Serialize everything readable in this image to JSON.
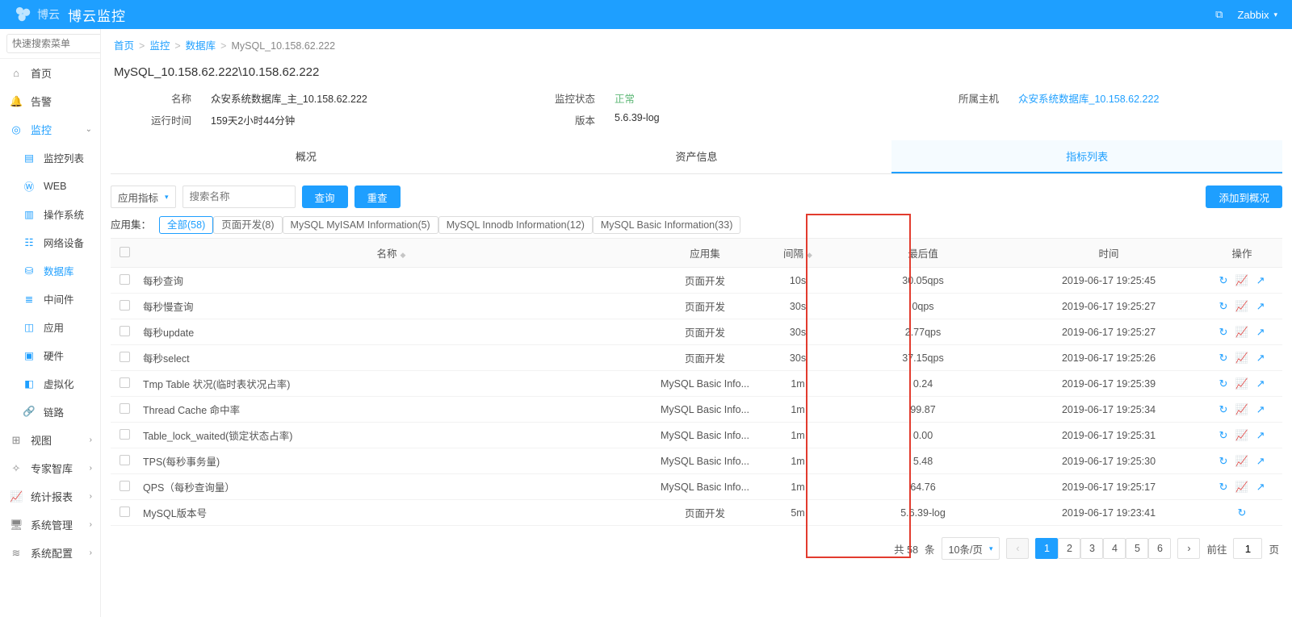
{
  "topbar": {
    "brand": "博云",
    "title": "博云监控",
    "user": "Zabbix"
  },
  "sidebar": {
    "search_placeholder": "快速搜索菜单",
    "items": [
      {
        "icon": "⌂",
        "label": "首页"
      },
      {
        "icon": "🔔",
        "label": "告警"
      },
      {
        "icon": "◎",
        "label": "监控",
        "open": true,
        "children": [
          {
            "icon": "▤",
            "label": "监控列表"
          },
          {
            "icon": "Ⓦ",
            "label": "WEB"
          },
          {
            "icon": "▥",
            "label": "操作系统"
          },
          {
            "icon": "☷",
            "label": "网络设备"
          },
          {
            "icon": "⛁",
            "label": "数据库",
            "active": true
          },
          {
            "icon": "≣",
            "label": "中间件"
          },
          {
            "icon": "◫",
            "label": "应用"
          },
          {
            "icon": "▣",
            "label": "硬件"
          },
          {
            "icon": "◧",
            "label": "虚拟化"
          },
          {
            "icon": "🔗",
            "label": "链路"
          }
        ]
      },
      {
        "icon": "⊞",
        "label": "视图",
        "chev": true
      },
      {
        "icon": "✧",
        "label": "专家智库",
        "chev": true
      },
      {
        "icon": "📈",
        "label": "统计报表",
        "chev": true
      },
      {
        "icon": "🖥",
        "label": "系统管理",
        "chev": true
      },
      {
        "icon": "≋",
        "label": "系统配置",
        "chev": true
      }
    ]
  },
  "breadcrumb": [
    "首页",
    "监控",
    "数据库",
    "MySQL_10.158.62.222"
  ],
  "page_title": "MySQL_10.158.62.222\\10.158.62.222",
  "info": {
    "r1": {
      "name_lab": "名称",
      "name_val": "众安系统数据库_主_10.158.62.222",
      "status_lab": "监控状态",
      "status_val": "正常",
      "host_lab": "所属主机",
      "host_val": "众安系统数据库_10.158.62.222"
    },
    "r2": {
      "uptime_lab": "运行时间",
      "uptime_val": "159天2小时44分钟",
      "ver_lab": "版本",
      "ver_val": "5.6.39-log"
    }
  },
  "tabs": [
    "概况",
    "资产信息",
    "指标列表"
  ],
  "toolbar": {
    "select_label": "应用指标",
    "search_placeholder": "搜索名称",
    "query": "查询",
    "reset": "重查",
    "add_overview": "添加到概况"
  },
  "filters": {
    "label": "应用集：",
    "items": [
      {
        "label": "全部(58)",
        "active": true
      },
      {
        "label": "页面开发(8)"
      },
      {
        "label": "MySQL MyISAM Information(5)"
      },
      {
        "label": "MySQL Innodb Information(12)"
      },
      {
        "label": "MySQL Basic Information(33)"
      }
    ]
  },
  "columns": [
    "",
    "名称",
    "应用集",
    "间隔",
    "最后值",
    "时间",
    "操作"
  ],
  "rows": [
    {
      "name": "每秒查询",
      "set": "页面开发",
      "intv": "10s",
      "last": "30.05qps",
      "time": "2019-06-17 19:25:45",
      "ops": 3
    },
    {
      "name": "每秒慢查询",
      "set": "页面开发",
      "intv": "30s",
      "last": "0qps",
      "time": "2019-06-17 19:25:27",
      "ops": 3
    },
    {
      "name": "每秒update",
      "set": "页面开发",
      "intv": "30s",
      "last": "2.77qps",
      "time": "2019-06-17 19:25:27",
      "ops": 3
    },
    {
      "name": "每秒select",
      "set": "页面开发",
      "intv": "30s",
      "last": "37.15qps",
      "time": "2019-06-17 19:25:26",
      "ops": 3
    },
    {
      "name": "Tmp Table 状况(临时表状况占率)",
      "set": "MySQL Basic Info...",
      "intv": "1m",
      "last": "0.24",
      "time": "2019-06-17 19:25:39",
      "ops": 3
    },
    {
      "name": "Thread Cache 命中率",
      "set": "MySQL Basic Info...",
      "intv": "1m",
      "last": "99.87",
      "time": "2019-06-17 19:25:34",
      "ops": 3
    },
    {
      "name": "Table_lock_waited(锁定状态占率)",
      "set": "MySQL Basic Info...",
      "intv": "1m",
      "last": "0.00",
      "time": "2019-06-17 19:25:31",
      "ops": 3
    },
    {
      "name": "TPS(每秒事务量)",
      "set": "MySQL Basic Info...",
      "intv": "1m",
      "last": "5.48",
      "time": "2019-06-17 19:25:30",
      "ops": 3
    },
    {
      "name": "QPS（每秒查询量）",
      "set": "MySQL Basic Info...",
      "intv": "1m",
      "last": "64.76",
      "time": "2019-06-17 19:25:17",
      "ops": 3
    },
    {
      "name": "MySQL版本号",
      "set": "页面开发",
      "intv": "5m",
      "last": "5.6.39-log",
      "time": "2019-06-17 19:23:41",
      "ops": 1
    }
  ],
  "pager": {
    "total_pre": "共 58",
    "total_suf": "条",
    "page_size": "10条/页",
    "pages": [
      "1",
      "2",
      "3",
      "4",
      "5",
      "6"
    ],
    "goto_pre": "前往",
    "goto_val": "1",
    "goto_suf": "页"
  }
}
